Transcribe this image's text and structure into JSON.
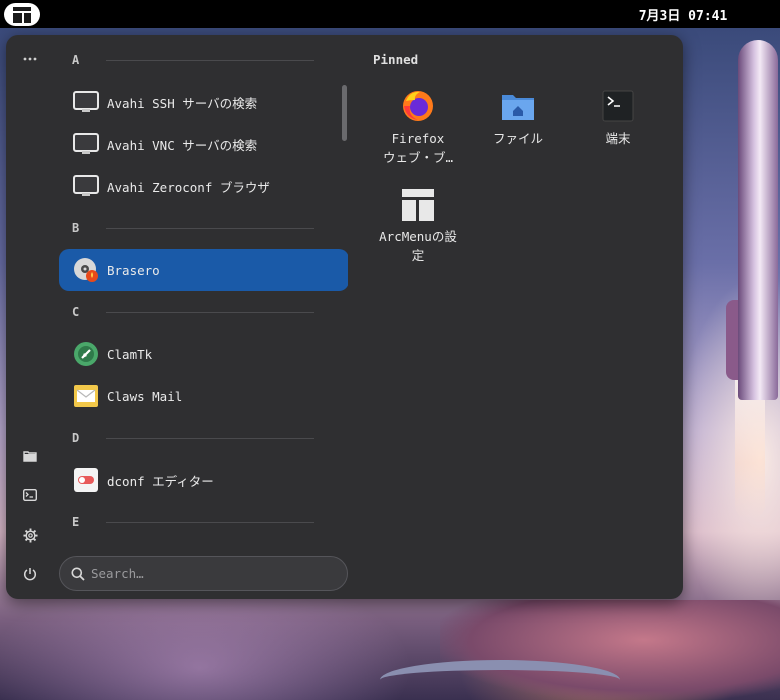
{
  "topbar": {
    "clock": "7月3日 07:41",
    "menu_icon": "arcmenu-icon"
  },
  "rail": {
    "more_icon": "more-horizontal-icon",
    "files_icon": "folder-icon",
    "terminal_icon": "terminal-icon",
    "settings_icon": "gear-icon",
    "power_icon": "power-icon"
  },
  "sections": {
    "a": "A",
    "b": "B",
    "c": "C",
    "d": "D",
    "e": "E"
  },
  "apps": [
    {
      "label": "Avahi SSH サーバの検索",
      "icon": "monitor-icon"
    },
    {
      "label": "Avahi VNC サーバの検索",
      "icon": "monitor-icon"
    },
    {
      "label": "Avahi Zeroconf ブラウザ",
      "icon": "monitor-icon"
    },
    {
      "label": "Brasero",
      "icon": "disc-burner-icon",
      "selected": true
    },
    {
      "label": "ClamTk",
      "icon": "shield-icon"
    },
    {
      "label": "Claws Mail",
      "icon": "envelope-icon"
    },
    {
      "label": "dconf エディター",
      "icon": "toggle-icon"
    }
  ],
  "pinned": {
    "title": "Pinned",
    "items": [
      {
        "line1": "Firefox",
        "line2": "ウェブ・ブ…",
        "icon": "firefox-icon"
      },
      {
        "line1": "ファイル",
        "line2": "",
        "icon": "folder-home-icon"
      },
      {
        "line1": "端末",
        "line2": "",
        "icon": "terminal-icon"
      },
      {
        "line1": "ArcMenuの設",
        "line2": "定",
        "icon": "arcmenu-settings-icon"
      }
    ]
  },
  "search": {
    "placeholder": "Search…",
    "icon": "search-icon"
  },
  "colors": {
    "selected": "#1a5aa8",
    "panel": "#2f2f31",
    "topbar": "#000000"
  }
}
